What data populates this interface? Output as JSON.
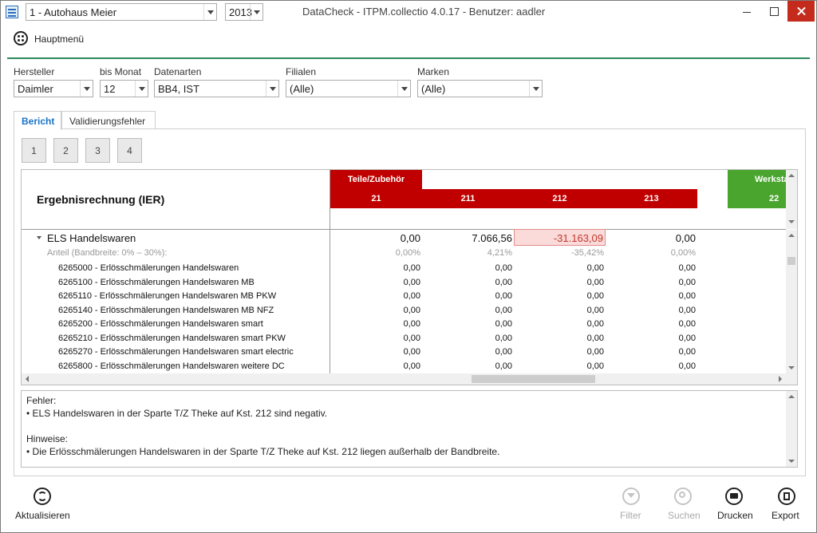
{
  "titlebar": {
    "dealer": "1 - Autohaus Meier",
    "year": "2013",
    "window_title": "DataCheck - ITPM.collectio 4.0.17 - Benutzer: aadler"
  },
  "menu": {
    "main_menu": "Hauptmenü"
  },
  "filters": {
    "hersteller": {
      "label": "Hersteller",
      "value": "Daimler"
    },
    "bis_monat": {
      "label": "bis Monat",
      "value": "12"
    },
    "datenarten": {
      "label": "Datenarten",
      "value": "BB4, IST"
    },
    "filialen": {
      "label": "Filialen",
      "value": "(Alle)"
    },
    "marken": {
      "label": "Marken",
      "value": "(Alle)"
    }
  },
  "tabs": {
    "bericht": "Bericht",
    "validierungsfehler": "Validierungsfehler"
  },
  "page_buttons": [
    "1",
    "2",
    "3",
    "4"
  ],
  "grid": {
    "title": "Ergebnisrechnung (IER)",
    "groups": [
      {
        "label": "Teile/Zubehör",
        "color": "#c00000"
      },
      {
        "label": "Werksta",
        "color": "#4aa52e"
      }
    ],
    "columns": [
      "21",
      "211",
      "212",
      "213",
      "22"
    ],
    "summary": {
      "label": "ELS Handelswaren",
      "values": [
        "0,00",
        "7.066,56",
        "-31.163,09",
        "0,00"
      ]
    },
    "share": {
      "label": "Anteil (Bandbreite: 0% – 30%):",
      "values": [
        "0,00%",
        "4,21%",
        "-35,42%",
        "0,00%"
      ]
    },
    "accounts": [
      {
        "label": "6265000 - Erlösschmälerungen Handelswaren",
        "values": [
          "0,00",
          "0,00",
          "0,00",
          "0,00"
        ]
      },
      {
        "label": "6265100 - Erlösschmälerungen Handelswaren MB",
        "values": [
          "0,00",
          "0,00",
          "0,00",
          "0,00"
        ]
      },
      {
        "label": "6265110 - Erlösschmälerungen Handelswaren MB PKW",
        "values": [
          "0,00",
          "0,00",
          "0,00",
          "0,00"
        ]
      },
      {
        "label": "6265140 - Erlösschmälerungen Handelswaren MB NFZ",
        "values": [
          "0,00",
          "0,00",
          "0,00",
          "0,00"
        ]
      },
      {
        "label": "6265200 - Erlösschmälerungen Handelswaren smart",
        "values": [
          "0,00",
          "0,00",
          "0,00",
          "0,00"
        ]
      },
      {
        "label": "6265210 - Erlösschmälerungen Handelswaren smart PKW",
        "values": [
          "0,00",
          "0,00",
          "0,00",
          "0,00"
        ]
      },
      {
        "label": "6265270 - Erlösschmälerungen Handelswaren smart electric",
        "values": [
          "0,00",
          "0,00",
          "0,00",
          "0,00"
        ]
      },
      {
        "label": "6265800 - Erlösschmälerungen Handelswaren weitere DC",
        "values": [
          "0,00",
          "0,00",
          "0,00",
          "0,00"
        ]
      }
    ]
  },
  "messages": {
    "errors_heading": "Fehler:",
    "error_1": "• ELS Handelswaren in der Sparte T/Z Theke auf Kst. 212 sind negativ.",
    "hints_heading": "Hinweise:",
    "hint_1": "• Die Erlösschmälerungen Handelswaren in der Sparte T/Z Theke auf Kst. 212 liegen außerhalb der Bandbreite."
  },
  "toolbar": {
    "refresh": "Aktualisieren",
    "filter": "Filter",
    "search": "Suchen",
    "print": "Drucken",
    "export": "Export"
  },
  "icons": {
    "app": "app-icon",
    "main_menu": "grid-menu-icon",
    "refresh": "refresh-icon",
    "filter": "funnel-icon",
    "search": "search-icon",
    "print": "printer-icon",
    "export": "export-icon"
  },
  "colors": {
    "accent": "#2a8a5c",
    "tab_active": "#1a73c8",
    "error_cell_bg": "#fbdada",
    "error_text": "#c0392b"
  }
}
